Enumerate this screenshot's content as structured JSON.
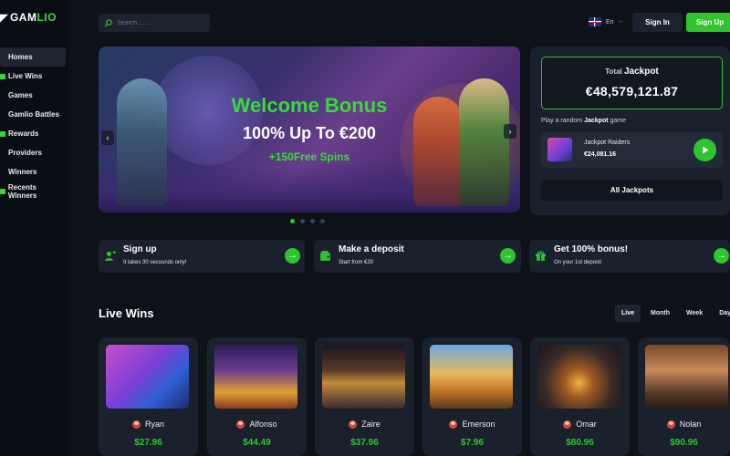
{
  "brand": {
    "logo_text_1": "GAM",
    "logo_text_2": "LIO"
  },
  "sidebar": {
    "items": [
      {
        "label": "Homes",
        "active": true,
        "icon": "home-icon"
      },
      {
        "label": "Live Wins",
        "active": false,
        "icon": "trophy-icon"
      },
      {
        "label": "Games",
        "active": false,
        "icon": ""
      },
      {
        "label": "Gamlio Battles",
        "active": false,
        "icon": ""
      },
      {
        "label": "Rewards",
        "active": false,
        "icon": "gift-icon"
      },
      {
        "label": "Providers",
        "active": false,
        "icon": ""
      },
      {
        "label": "Winners",
        "active": false,
        "icon": ""
      },
      {
        "label": "Recents Winners",
        "active": false,
        "icon": "clock-icon"
      }
    ]
  },
  "header": {
    "search_placeholder": "Search........",
    "language": "En",
    "signin_label": "Sign In",
    "signup_label": "Sign Up"
  },
  "banner": {
    "title": "Welcome Bonus",
    "line2": "100% Up To €200",
    "line3": "+150Free Spins",
    "slides": 4,
    "active_slide": 1
  },
  "jackpot": {
    "label_prefix": "Total",
    "label_main": "Jackpot",
    "amount": "€48,579,121.87",
    "random_prefix": "Play a random",
    "random_bold": "Jackpot",
    "random_suffix": "game",
    "game_name": "Jackpot Raiders",
    "game_amount": "€24,081.16",
    "all_label": "All Jackpots"
  },
  "promos": [
    {
      "title": "Sign up",
      "subtitle": "It takes 30 secounds only!"
    },
    {
      "title": "Make a deposit",
      "subtitle": "Start from €20"
    },
    {
      "title": "Get 100% bonus!",
      "subtitle": "On your 1st deposit"
    }
  ],
  "live_wins": {
    "title": "Live Wins",
    "tabs": [
      "Live",
      "Month",
      "Week",
      "Day"
    ],
    "active_tab": "Live",
    "cards": [
      {
        "user": "Ryan",
        "amount": "$27.96"
      },
      {
        "user": "Alfonso",
        "amount": "$44.49"
      },
      {
        "user": "Zaire",
        "amount": "$37.96"
      },
      {
        "user": "Emerson",
        "amount": "$7.96"
      },
      {
        "user": "Omar",
        "amount": "$80.96"
      },
      {
        "user": "Nolan",
        "amount": "$90.96"
      }
    ]
  },
  "colors": {
    "accent": "#2ec52e",
    "background": "#0d1118",
    "panel": "#1a212c"
  }
}
